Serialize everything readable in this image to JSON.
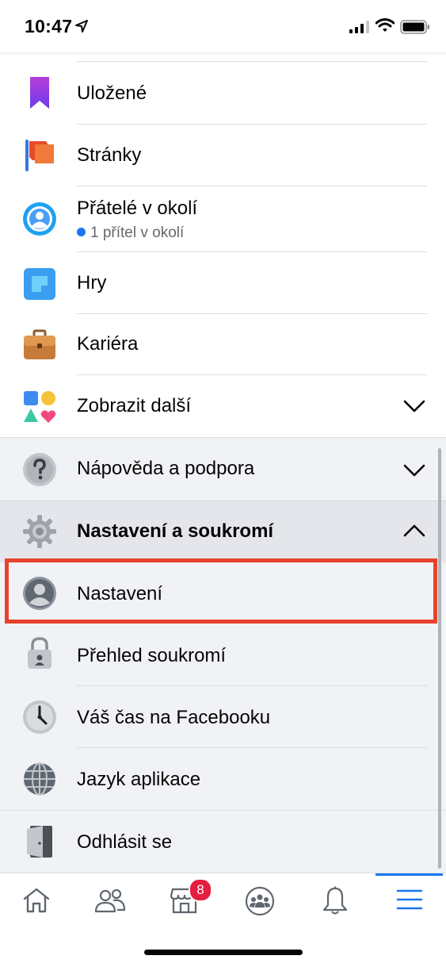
{
  "status_bar": {
    "time": "10:47"
  },
  "menu": {
    "items": [
      {
        "label": "Uložené"
      },
      {
        "label": "Stránky"
      },
      {
        "label": "Přátelé v okolí",
        "sublabel": "1 přítel v okolí"
      },
      {
        "label": "Hry"
      },
      {
        "label": "Kariéra"
      },
      {
        "label": "Zobrazit další"
      }
    ],
    "help": {
      "label": "Nápověda a podpora"
    },
    "settings_section": {
      "label": "Nastavení a soukromí",
      "items": [
        {
          "label": "Nastavení"
        },
        {
          "label": "Přehled soukromí"
        },
        {
          "label": "Váš čas na Facebooku"
        },
        {
          "label": "Jazyk aplikace"
        }
      ]
    },
    "logout": {
      "label": "Odhlásit se"
    }
  },
  "tabbar": {
    "tabs": [
      {
        "icon": "home-icon"
      },
      {
        "icon": "friends-icon"
      },
      {
        "icon": "marketplace-icon",
        "badge": "8"
      },
      {
        "icon": "groups-icon"
      },
      {
        "icon": "bell-icon"
      },
      {
        "icon": "menu-icon",
        "active": true
      }
    ]
  },
  "colors": {
    "accent": "#1877f2",
    "highlight": "#e8412c",
    "badge": "#e41e3f"
  }
}
